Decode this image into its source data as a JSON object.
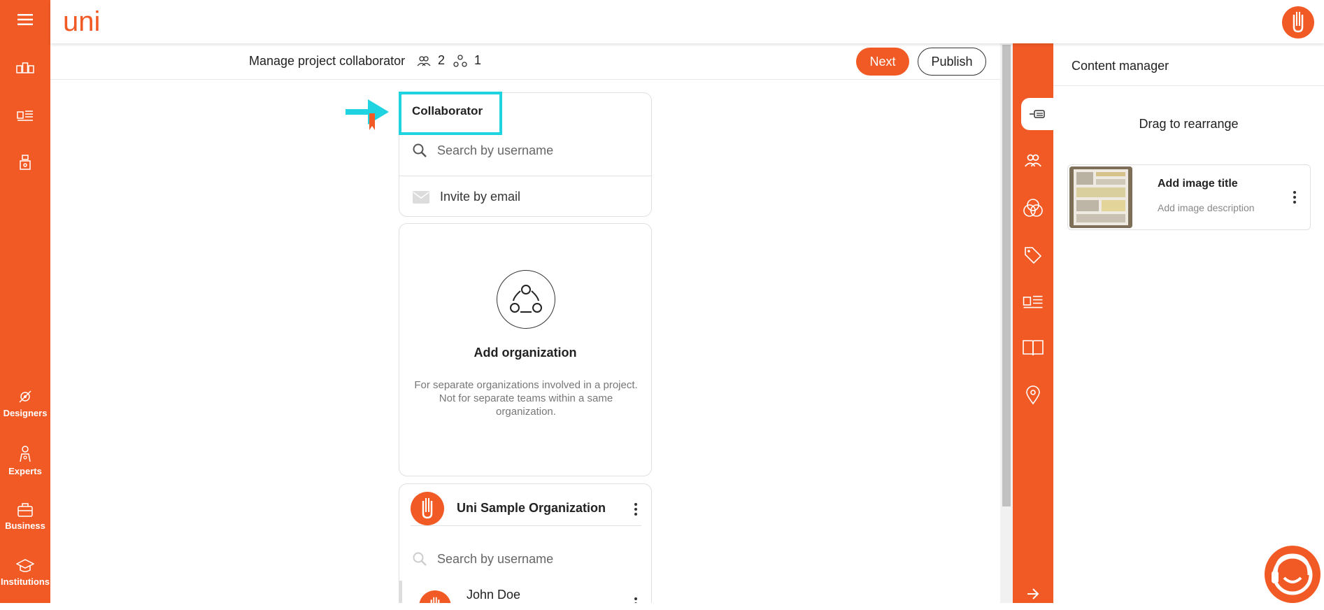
{
  "app": {
    "logo_text": "uni"
  },
  "left_rail": {
    "items": [
      {
        "label": "Designers",
        "icon": "designers-icon"
      },
      {
        "label": "Experts",
        "icon": "experts-icon"
      },
      {
        "label": "Business",
        "icon": "business-icon"
      },
      {
        "label": "Institutions",
        "icon": "institutions-icon"
      }
    ]
  },
  "subheader": {
    "title": "Manage project collaborator",
    "collaborator_count": "2",
    "organization_count": "1",
    "next_label": "Next",
    "publish_label": "Publish"
  },
  "collaborator_card": {
    "title": "Collaborator",
    "search_placeholder": "Search by username",
    "invite_label": "Invite by email"
  },
  "organization_empty": {
    "title": "Add organization",
    "description": "For separate organizations involved in a project. Not for separate teams within a same organization."
  },
  "organization_card": {
    "name": "Uni Sample Organization",
    "search_placeholder": "Search by username",
    "member_name": "John Doe"
  },
  "content_manager": {
    "title": "Content manager",
    "drag_hint": "Drag to rearrange",
    "item_title": "Add image title",
    "item_description": "Add image description"
  },
  "colors": {
    "accent": "#f15a24",
    "highlight": "#1fd3e0"
  }
}
